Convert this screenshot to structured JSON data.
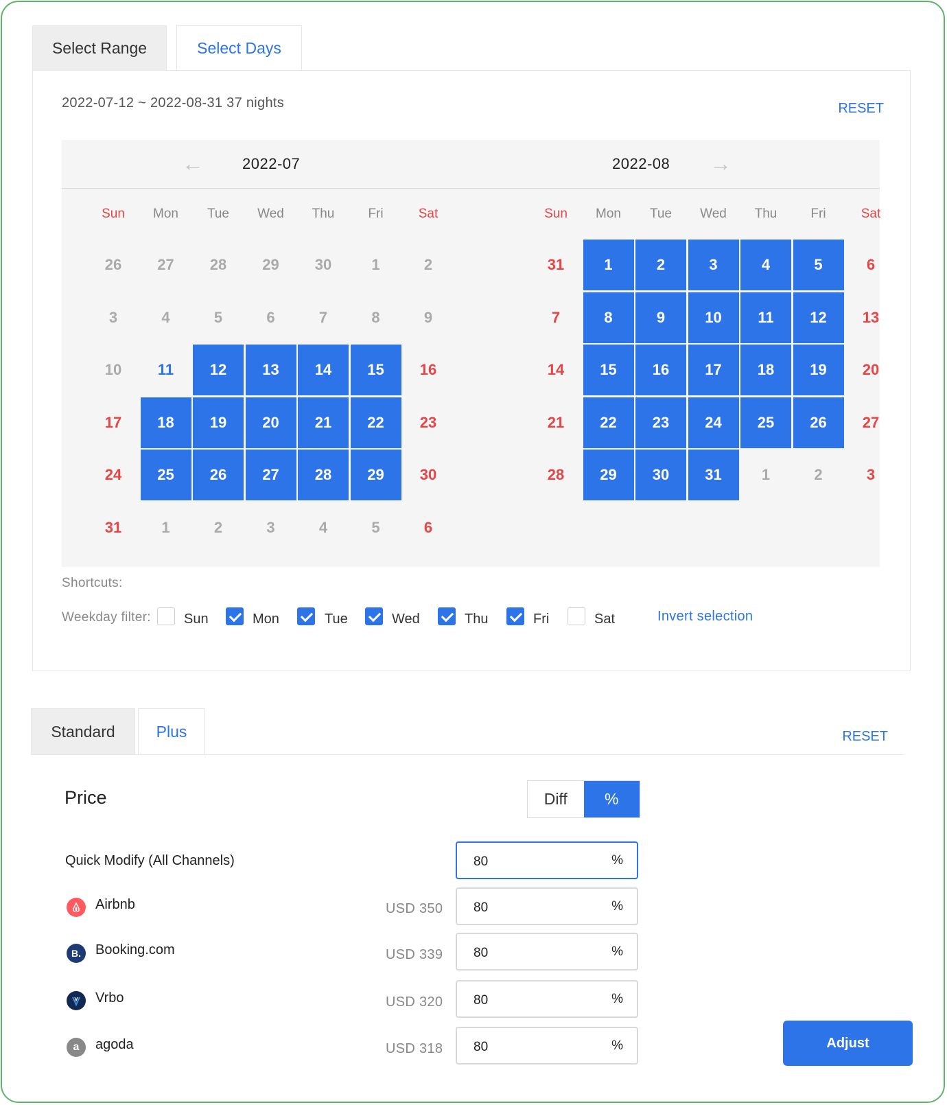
{
  "tabs_top": {
    "select_range": "Select Range",
    "select_days": "Select Days"
  },
  "range_text": "2022-07-12 ~ 2022-08-31 37 nights",
  "reset_label": "RESET",
  "calendar": {
    "prev_icon": "arrow-left-icon",
    "next_icon": "arrow-right-icon",
    "weekdays": [
      "Sun",
      "Mon",
      "Tue",
      "Wed",
      "Thu",
      "Fri",
      "Sat"
    ],
    "months": [
      {
        "label": "2022-07",
        "weeks": [
          [
            {
              "d": "26",
              "s": "o"
            },
            {
              "d": "27",
              "s": "o"
            },
            {
              "d": "28",
              "s": "o"
            },
            {
              "d": "29",
              "s": "o"
            },
            {
              "d": "30",
              "s": "o"
            },
            {
              "d": "1",
              "s": "o"
            },
            {
              "d": "2",
              "s": "o"
            }
          ],
          [
            {
              "d": "3",
              "s": "o"
            },
            {
              "d": "4",
              "s": "o"
            },
            {
              "d": "5",
              "s": "o"
            },
            {
              "d": "6",
              "s": "o"
            },
            {
              "d": "7",
              "s": "o"
            },
            {
              "d": "8",
              "s": "o"
            },
            {
              "d": "9",
              "s": "o"
            }
          ],
          [
            {
              "d": "10",
              "s": "o"
            },
            {
              "d": "11",
              "s": "b"
            },
            {
              "d": "12",
              "s": "s"
            },
            {
              "d": "13",
              "s": "s"
            },
            {
              "d": "14",
              "s": "s"
            },
            {
              "d": "15",
              "s": "s"
            },
            {
              "d": "16",
              "s": "w"
            }
          ],
          [
            {
              "d": "17",
              "s": "w"
            },
            {
              "d": "18",
              "s": "s"
            },
            {
              "d": "19",
              "s": "s"
            },
            {
              "d": "20",
              "s": "s"
            },
            {
              "d": "21",
              "s": "s"
            },
            {
              "d": "22",
              "s": "s"
            },
            {
              "d": "23",
              "s": "w"
            }
          ],
          [
            {
              "d": "24",
              "s": "w"
            },
            {
              "d": "25",
              "s": "s"
            },
            {
              "d": "26",
              "s": "s"
            },
            {
              "d": "27",
              "s": "s"
            },
            {
              "d": "28",
              "s": "s"
            },
            {
              "d": "29",
              "s": "s"
            },
            {
              "d": "30",
              "s": "w"
            }
          ],
          [
            {
              "d": "31",
              "s": "w"
            },
            {
              "d": "1",
              "s": "o"
            },
            {
              "d": "2",
              "s": "o"
            },
            {
              "d": "3",
              "s": "o"
            },
            {
              "d": "4",
              "s": "o"
            },
            {
              "d": "5",
              "s": "o"
            },
            {
              "d": "6",
              "s": "w"
            }
          ]
        ]
      },
      {
        "label": "2022-08",
        "weeks": [
          [
            {
              "d": "31",
              "s": "w"
            },
            {
              "d": "1",
              "s": "s"
            },
            {
              "d": "2",
              "s": "s"
            },
            {
              "d": "3",
              "s": "s"
            },
            {
              "d": "4",
              "s": "s"
            },
            {
              "d": "5",
              "s": "s"
            },
            {
              "d": "6",
              "s": "w"
            }
          ],
          [
            {
              "d": "7",
              "s": "w"
            },
            {
              "d": "8",
              "s": "s"
            },
            {
              "d": "9",
              "s": "s"
            },
            {
              "d": "10",
              "s": "s"
            },
            {
              "d": "11",
              "s": "s"
            },
            {
              "d": "12",
              "s": "s"
            },
            {
              "d": "13",
              "s": "w"
            }
          ],
          [
            {
              "d": "14",
              "s": "w"
            },
            {
              "d": "15",
              "s": "s"
            },
            {
              "d": "16",
              "s": "s"
            },
            {
              "d": "17",
              "s": "s"
            },
            {
              "d": "18",
              "s": "s"
            },
            {
              "d": "19",
              "s": "s"
            },
            {
              "d": "20",
              "s": "w"
            }
          ],
          [
            {
              "d": "21",
              "s": "w"
            },
            {
              "d": "22",
              "s": "s"
            },
            {
              "d": "23",
              "s": "s"
            },
            {
              "d": "24",
              "s": "s"
            },
            {
              "d": "25",
              "s": "s"
            },
            {
              "d": "26",
              "s": "s"
            },
            {
              "d": "27",
              "s": "w"
            }
          ],
          [
            {
              "d": "28",
              "s": "w"
            },
            {
              "d": "29",
              "s": "s"
            },
            {
              "d": "30",
              "s": "s"
            },
            {
              "d": "31",
              "s": "s"
            },
            {
              "d": "1",
              "s": "o"
            },
            {
              "d": "2",
              "s": "o"
            },
            {
              "d": "3",
              "s": "w"
            }
          ]
        ]
      }
    ]
  },
  "shortcuts_label": "Shortcuts:",
  "weekday_filter": {
    "label": "Weekday filter:",
    "days": [
      {
        "label": "Sun",
        "checked": false
      },
      {
        "label": "Mon",
        "checked": true
      },
      {
        "label": "Tue",
        "checked": true
      },
      {
        "label": "Wed",
        "checked": true
      },
      {
        "label": "Thu",
        "checked": true
      },
      {
        "label": "Fri",
        "checked": true
      },
      {
        "label": "Sat",
        "checked": false
      }
    ],
    "invert_label": "Invert selection"
  },
  "tabs_bottom": {
    "standard": "Standard",
    "plus": "Plus"
  },
  "price": {
    "title": "Price",
    "toggle": {
      "diff": "Diff",
      "percent": "%",
      "selected": "%"
    },
    "quick_modify": {
      "label": "Quick Modify (All Channels)",
      "value": "80",
      "unit": "%"
    },
    "channels": [
      {
        "name": "Airbnb",
        "base": "USD 350",
        "value": "80",
        "unit": "%",
        "icon": "airbnb-logo-icon",
        "color": "#ff5a5f"
      },
      {
        "name": "Booking.com",
        "base": "USD 339",
        "value": "80",
        "unit": "%",
        "icon": "booking-logo-icon",
        "color": "#1e3a75"
      },
      {
        "name": "Vrbo",
        "base": "USD 320",
        "value": "80",
        "unit": "%",
        "icon": "vrbo-logo-icon",
        "color": "#132952"
      },
      {
        "name": "agoda",
        "base": "USD 318",
        "value": "80",
        "unit": "%",
        "icon": "agoda-logo-icon",
        "color": "#888888"
      }
    ]
  },
  "adjust_label": "Adjust",
  "colors": {
    "accent": "#2c74e8",
    "weekend": "#e84646",
    "frame": "#5fb36a"
  }
}
